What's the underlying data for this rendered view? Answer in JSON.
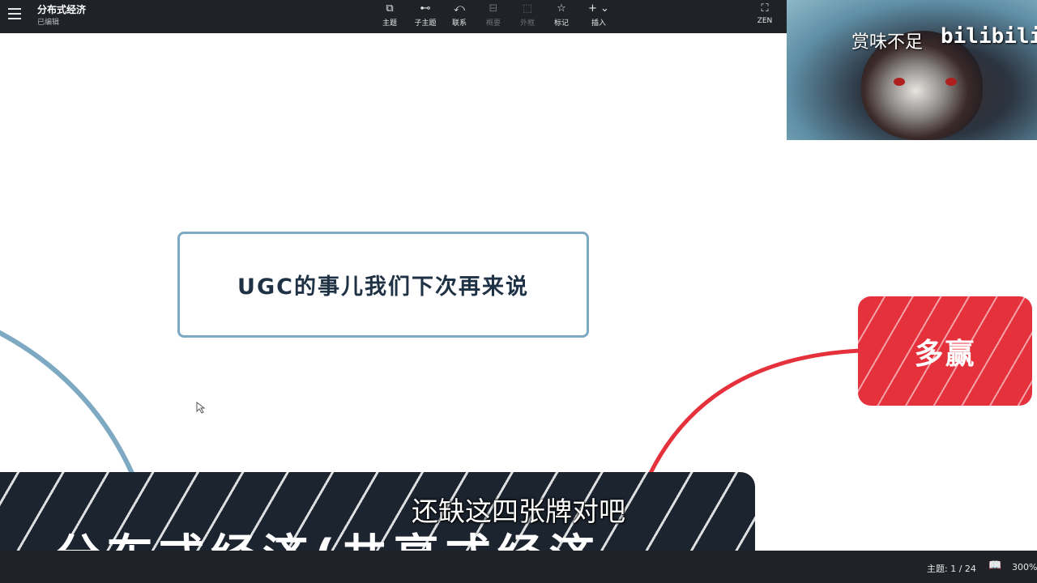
{
  "document": {
    "title": "分布式经济",
    "status": "已编辑"
  },
  "toolbar": {
    "tools": [
      {
        "icon": "⧉",
        "icon_name": "topic-icon",
        "label": "主题",
        "enabled": true
      },
      {
        "icon": "⊷",
        "icon_name": "subtopic-icon",
        "label": "子主题",
        "enabled": true
      },
      {
        "icon": "⤺",
        "icon_name": "relationship-icon",
        "label": "联系",
        "enabled": true
      },
      {
        "icon": "⊟",
        "icon_name": "summary-icon",
        "label": "概要",
        "enabled": false
      },
      {
        "icon": "⬚",
        "icon_name": "boundary-icon",
        "label": "外框",
        "enabled": false
      },
      {
        "icon": "☆",
        "icon_name": "marker-star-icon",
        "label": "标记",
        "enabled": true
      },
      {
        "icon": "+ ⌄",
        "icon_name": "insert-icon",
        "label": "插入",
        "enabled": true
      }
    ],
    "zen": {
      "icon": "⛶",
      "icon_name": "fullscreen-icon",
      "label": "ZEN"
    }
  },
  "canvas": {
    "topic_text": "UGC的事儿我们下次再来说",
    "win_text": "多赢",
    "colors": {
      "left_branch": "#7ea9c2",
      "right_branch": "#e5313c",
      "topic_border": "#7ea9c2",
      "win_fill": "#e5313c"
    }
  },
  "overlay": {
    "caption": "赏味不足",
    "logo": "bilibili"
  },
  "banner": {
    "big_text": "分布式经济(共享式经济",
    "subtitle": "还缺这四张牌对吧"
  },
  "statusbar": {
    "topic_count": "主题: 1 / 24",
    "book_icon": "book-icon",
    "zoom": "300%"
  }
}
